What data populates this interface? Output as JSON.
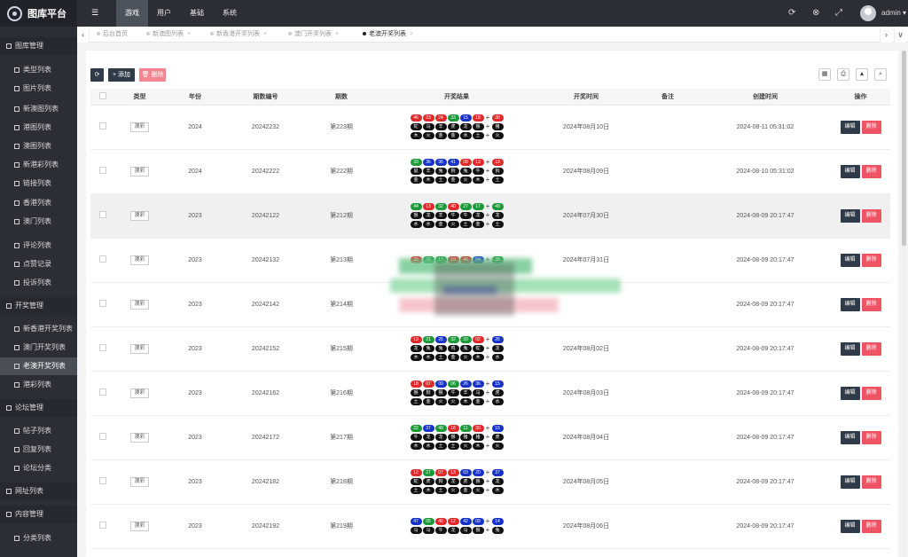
{
  "app": {
    "title": "图库平台",
    "user": "admin"
  },
  "topnav": [
    {
      "label": "游戏"
    },
    {
      "label": "用户"
    },
    {
      "label": "基础"
    },
    {
      "label": "系统"
    }
  ],
  "sidebar": [
    {
      "label": "图库管理",
      "group": true
    },
    {
      "label": "类型列表"
    },
    {
      "label": "图片列表"
    },
    {
      "label": "新澳图列表"
    },
    {
      "label": "港图列表"
    },
    {
      "label": "澳图列表"
    },
    {
      "label": "新港彩列表"
    },
    {
      "label": "链接列表"
    },
    {
      "label": "香港列表"
    },
    {
      "label": "澳门列表"
    },
    {
      "label": "评论列表"
    },
    {
      "label": "点赞记录"
    },
    {
      "label": "投诉列表"
    },
    {
      "label": "开奖管理",
      "group": true
    },
    {
      "label": "新香港开奖列表"
    },
    {
      "label": "澳门开奖列表"
    },
    {
      "label": "老澳开奖列表",
      "active": true
    },
    {
      "label": "港彩列表"
    },
    {
      "label": "论坛管理",
      "group": true
    },
    {
      "label": "帖子列表"
    },
    {
      "label": "回复列表"
    },
    {
      "label": "论坛分类"
    },
    {
      "label": "网址列表",
      "group": true
    },
    {
      "label": "内容管理",
      "group": true
    },
    {
      "label": "分类列表"
    }
  ],
  "tabs": [
    {
      "label": "后台首页"
    },
    {
      "label": "新澳图列表"
    },
    {
      "label": "新香港开奖列表"
    },
    {
      "label": "澳门开奖列表"
    },
    {
      "label": "老澳开奖列表",
      "active": true
    }
  ],
  "toolbar": {
    "add_label": "+ 添加",
    "delete_label": "删除"
  },
  "table": {
    "headers": [
      "类型",
      "年份",
      "期数编号",
      "期数",
      "开奖结果",
      "开奖时间",
      "备注",
      "创建时间",
      "操作"
    ],
    "edit_label": "编辑",
    "delete_label": "删除",
    "rows": [
      {
        "type": "澳彩",
        "year": "2024",
        "code": "20242232",
        "issue": "第223期",
        "time": "2024年08月10日",
        "note": "",
        "created": "2024-08-11 05:31:02",
        "numbers": [
          [
            "46",
            "red"
          ],
          [
            "23",
            "red"
          ],
          [
            "24",
            "red"
          ],
          [
            "33",
            "green"
          ],
          [
            "15",
            "blue"
          ],
          [
            "18",
            "red"
          ],
          [
            "30",
            "red"
          ]
        ],
        "zodiac": [
          "蛇",
          "马",
          "羊",
          "虎",
          "龙",
          "猴",
          "猪"
        ],
        "elements": [
          "木",
          "火",
          "金",
          "金",
          "水",
          "土",
          "火"
        ]
      },
      {
        "type": "澳彩",
        "year": "2024",
        "code": "20242222",
        "issue": "第222期",
        "time": "2024年08月09日",
        "note": "",
        "created": "2024-08-10 05:31:02",
        "numbers": [
          [
            "33",
            "green"
          ],
          [
            "36",
            "blue"
          ],
          [
            "36",
            "blue"
          ],
          [
            "41",
            "blue"
          ],
          [
            "08",
            "red"
          ],
          [
            "13",
            "red"
          ],
          [
            "19",
            "red"
          ]
        ],
        "zodiac": [
          "鼠",
          "羊",
          "兔",
          "狗",
          "兔",
          "牛",
          "狗"
        ],
        "elements": [
          "金",
          "木",
          "土",
          "金",
          "火",
          "木",
          "土"
        ]
      },
      {
        "type": "澳彩",
        "year": "2023",
        "code": "20242122",
        "issue": "第212期",
        "time": "2024年07月30日",
        "note": "",
        "created": "2024-08-09 20:17:47",
        "highlight": true,
        "numbers": [
          [
            "44",
            "green"
          ],
          [
            "13",
            "red"
          ],
          [
            "32",
            "green"
          ],
          [
            "40",
            "red"
          ],
          [
            "27",
            "green"
          ],
          [
            "17",
            "green"
          ],
          [
            "49",
            "green"
          ]
        ],
        "zodiac": [
          "猴",
          "龙",
          "羊",
          "牛",
          "牛",
          "龙",
          "龙"
        ],
        "elements": [
          "水",
          "水",
          "金",
          "火",
          "土",
          "金",
          "土"
        ]
      },
      {
        "type": "澳彩",
        "year": "2023",
        "code": "20242132",
        "issue": "第213期",
        "time": "2024年07月31日",
        "note": "",
        "created": "2024-08-09 20:17:47",
        "numbers": [
          [
            "20",
            "red"
          ],
          [
            "22",
            "green"
          ],
          [
            "17",
            "green"
          ],
          [
            "19",
            "red"
          ],
          [
            "40",
            "red"
          ],
          [
            "04",
            "blue"
          ],
          [
            "38",
            "green"
          ]
        ],
        "zodiac": [],
        "elements": []
      },
      {
        "type": "澳彩",
        "year": "2023",
        "code": "20242142",
        "issue": "第214期",
        "time": "",
        "note": "",
        "created": "2024-08-09 20:17:47",
        "numbers": [],
        "zodiac": [],
        "elements": []
      },
      {
        "type": "澳彩",
        "year": "2023",
        "code": "20242152",
        "issue": "第215期",
        "time": "2024年08月02日",
        "note": "",
        "created": "2024-08-09 20:17:47",
        "numbers": [
          [
            "13",
            "red"
          ],
          [
            "21",
            "green"
          ],
          [
            "26",
            "blue"
          ],
          [
            "32",
            "green"
          ],
          [
            "33",
            "green"
          ],
          [
            "02",
            "red"
          ],
          [
            "26",
            "blue"
          ]
        ],
        "zodiac": [
          "龙",
          "兔",
          "兔",
          "鸡",
          "兔",
          "蛇",
          "龙"
        ],
        "elements": [
          "木",
          "水",
          "土",
          "金",
          "火",
          "木",
          "水"
        ]
      },
      {
        "type": "澳彩",
        "year": "2023",
        "code": "20242162",
        "issue": "第216期",
        "time": "2024年08月03日",
        "note": "",
        "created": "2024-08-09 20:17:47",
        "numbers": [
          [
            "18",
            "red"
          ],
          [
            "07",
            "red"
          ],
          [
            "09",
            "blue"
          ],
          [
            "06",
            "green"
          ],
          [
            "26",
            "blue"
          ],
          [
            "36",
            "blue"
          ],
          [
            "15",
            "blue"
          ]
        ],
        "zodiac": [
          "猴",
          "狗",
          "猴",
          "牛",
          "羊",
          "马",
          "虎"
        ],
        "elements": [
          "土",
          "金",
          "火",
          "火",
          "木",
          "金",
          "水"
        ]
      },
      {
        "type": "澳彩",
        "year": "2023",
        "code": "20242172",
        "issue": "第217期",
        "time": "2024年08月04日",
        "note": "",
        "created": "2024-08-09 20:17:47",
        "numbers": [
          [
            "22",
            "green"
          ],
          [
            "37",
            "blue"
          ],
          [
            "49",
            "green"
          ],
          [
            "18",
            "red"
          ],
          [
            "11",
            "green"
          ],
          [
            "30",
            "red"
          ],
          [
            "15",
            "blue"
          ]
        ],
        "zodiac": [
          "牛",
          "龙",
          "龙",
          "猴",
          "猪",
          "猪",
          "虎"
        ],
        "elements": [
          "木",
          "水",
          "土",
          "土",
          "火",
          "木",
          "火"
        ]
      },
      {
        "type": "澳彩",
        "year": "2023",
        "code": "20242182",
        "issue": "第218期",
        "time": "2024年08月05日",
        "note": "",
        "created": "2024-08-09 20:17:47",
        "numbers": [
          [
            "12",
            "red"
          ],
          [
            "27",
            "green"
          ],
          [
            "07",
            "red"
          ],
          [
            "13",
            "red"
          ],
          [
            "03",
            "blue"
          ],
          [
            "20",
            "blue"
          ],
          [
            "37",
            "blue"
          ]
        ],
        "zodiac": [
          "蛇",
          "虎",
          "狗",
          "龙",
          "虎",
          "猴",
          "龙"
        ],
        "elements": [
          "土",
          "木",
          "土",
          "火",
          "金",
          "火",
          "木"
        ]
      },
      {
        "type": "澳彩",
        "year": "2023",
        "code": "20242192",
        "issue": "第219期",
        "time": "2024年08月06日",
        "note": "",
        "created": "2024-08-09 20:17:47",
        "numbers": [
          [
            "47",
            "blue"
          ],
          [
            "05",
            "green"
          ],
          [
            "40",
            "red"
          ],
          [
            "12",
            "red"
          ],
          [
            "42",
            "blue"
          ],
          [
            "09",
            "blue"
          ],
          [
            "14",
            "blue"
          ]
        ],
        "zodiac": [
          "马",
          "马",
          "牛",
          "龙",
          "马",
          "猴",
          "兔"
        ],
        "elements": []
      }
    ]
  }
}
